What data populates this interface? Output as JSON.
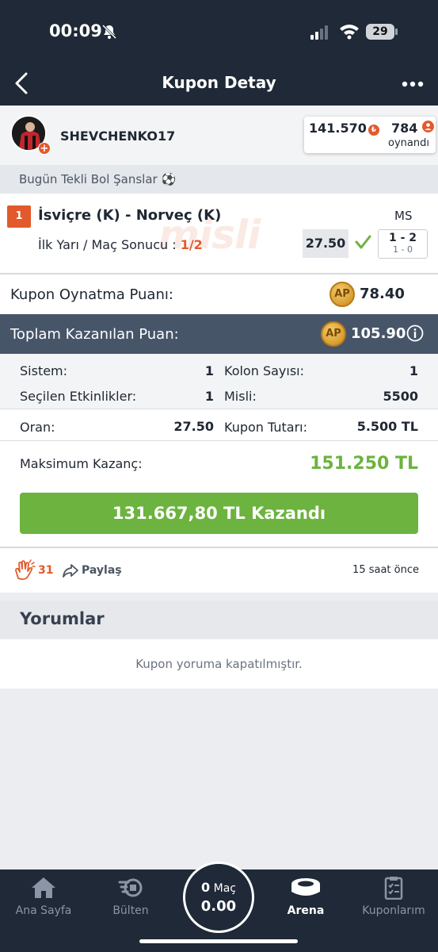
{
  "status_bar": {
    "time": "00:09",
    "battery": "29"
  },
  "nav": {
    "title": "Kupon Detay"
  },
  "user": {
    "username": "SHEVCHENKO17",
    "points": "141.570",
    "played_count": "784",
    "played_label": "oynandı"
  },
  "section": {
    "title": "Bugün Tekli Bol Şanslar",
    "emoji": "⚽"
  },
  "match": {
    "number": "1",
    "teams": "İsviçre (K) - Norveç (K)",
    "market_type": "MS",
    "pick_label": "İlk Yarı / Maç Sonucu :",
    "pick_value": "1/2",
    "odd": "27.50",
    "score_ft": "1 - 2",
    "score_ht": "1 - 0",
    "watermark": "misli"
  },
  "play_points": {
    "label": "Kupon Oynatma Puanı:",
    "badge": "AP",
    "value": "78.40"
  },
  "total_points": {
    "label": "Toplam Kazanılan Puan:",
    "badge": "AP",
    "value": "105.90"
  },
  "details": {
    "system_label": "Sistem:",
    "system_value": "1",
    "columns_label": "Kolon Sayısı:",
    "columns_value": "1",
    "events_label": "Seçilen Etkinlikler:",
    "events_value": "1",
    "misli_label": "Misli:",
    "misli_value": "5500",
    "odds_label": "Oran:",
    "odds_value": "27.50",
    "amount_label": "Kupon Tutarı:",
    "amount_value": "5.500 TL"
  },
  "max_win": {
    "label": "Maksimum Kazanç:",
    "value": "151.250 TL"
  },
  "won_button": {
    "label": "131.667,80 TL Kazandı"
  },
  "social": {
    "claps": "31",
    "share_label": "Paylaş",
    "time_ago": "15 saat önce"
  },
  "comments": {
    "title": "Yorumlar",
    "closed_text": "Kupon yoruma kapatılmıştır."
  },
  "tabbar": {
    "home": "Ana Sayfa",
    "bulletin": "Bülten",
    "center_count": "0",
    "center_label": "Maç",
    "center_amount": "0.00",
    "arena": "Arena",
    "coupons": "Kuponlarım"
  },
  "colors": {
    "accent": "#e25a2c",
    "success": "#6cb33f",
    "nav": "#1f2937",
    "slate": "#475569"
  }
}
